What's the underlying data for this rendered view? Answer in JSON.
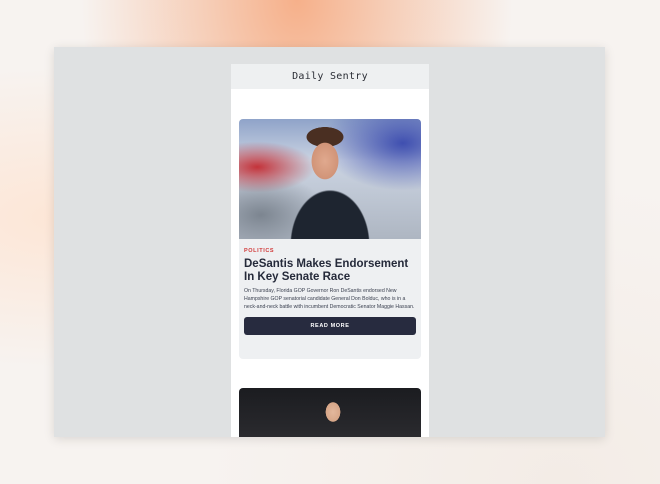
{
  "site": {
    "title": "Daily Sentry"
  },
  "articles": [
    {
      "category": "POLITICS",
      "headline": "DeSantis Makes Endorsement In Key Senate Race",
      "excerpt": "On Thursday, Florida GOP Governor Ron DeSantis endorsed New Hampshire GOP senatorial candidate General Don Bolduc, who is in a neck-and-neck battle with incumbent Democratic Senator Maggie Hassan.",
      "button": "READ MORE",
      "image": "photo-desantis"
    },
    {
      "image": "photo-basketball-player"
    }
  ]
}
